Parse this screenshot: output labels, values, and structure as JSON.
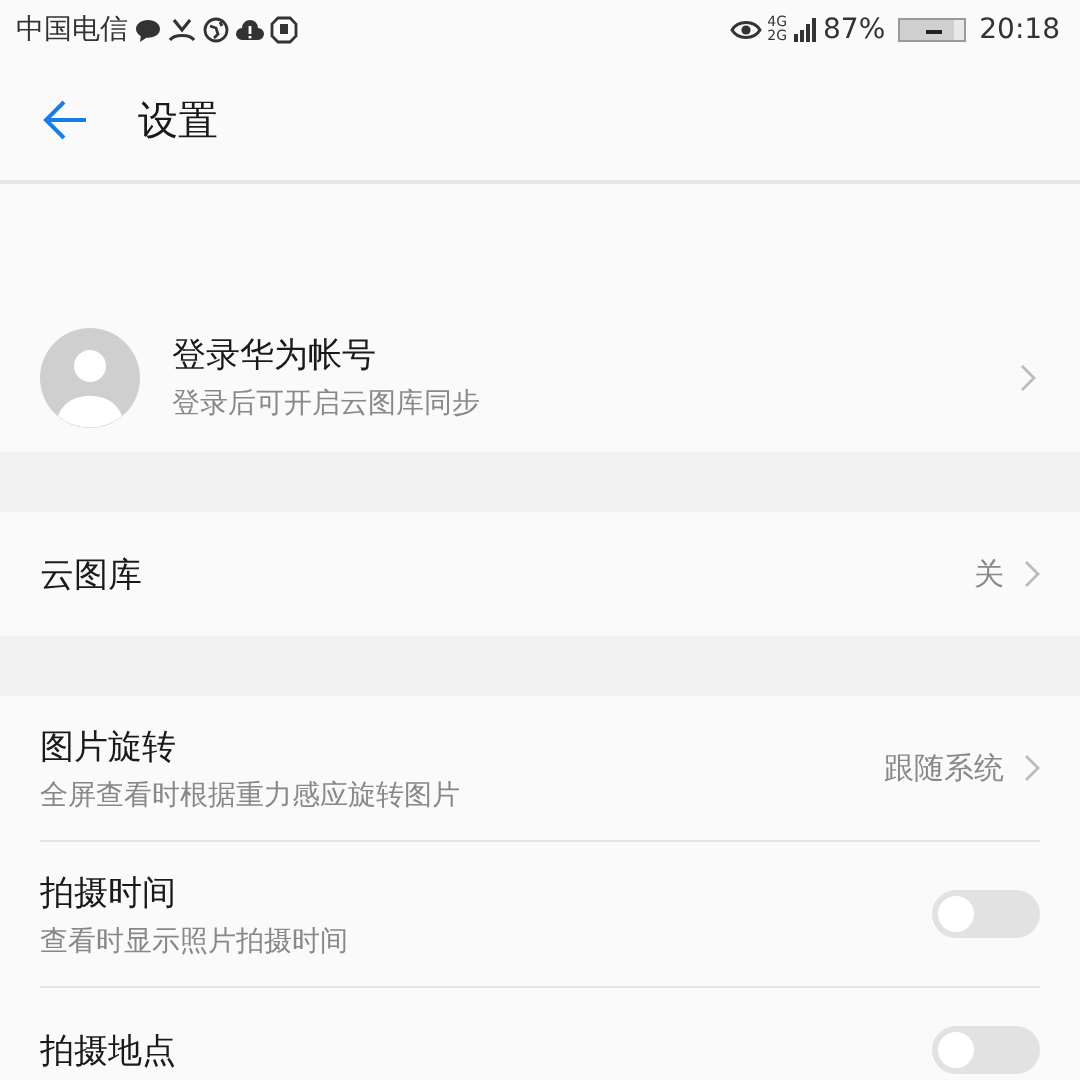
{
  "status_bar": {
    "carrier": "中国电信",
    "network_top": "4G",
    "network_bottom": "2G",
    "battery": "87%",
    "time": "20:18"
  },
  "header": {
    "title": "设置"
  },
  "account": {
    "title": "登录华为帐号",
    "subtitle": "登录后可开启云图库同步"
  },
  "sections": [
    [
      {
        "kind": "value",
        "title": "云图库",
        "value": "关"
      }
    ],
    [
      {
        "kind": "value",
        "title": "图片旋转",
        "subtitle": "全屏查看时根据重力感应旋转图片",
        "value": "跟随系统"
      },
      {
        "kind": "toggle",
        "title": "拍摄时间",
        "subtitle": "查看时显示照片拍摄时间",
        "on": false
      },
      {
        "kind": "toggle",
        "title": "拍摄地点",
        "on": false
      }
    ]
  ]
}
